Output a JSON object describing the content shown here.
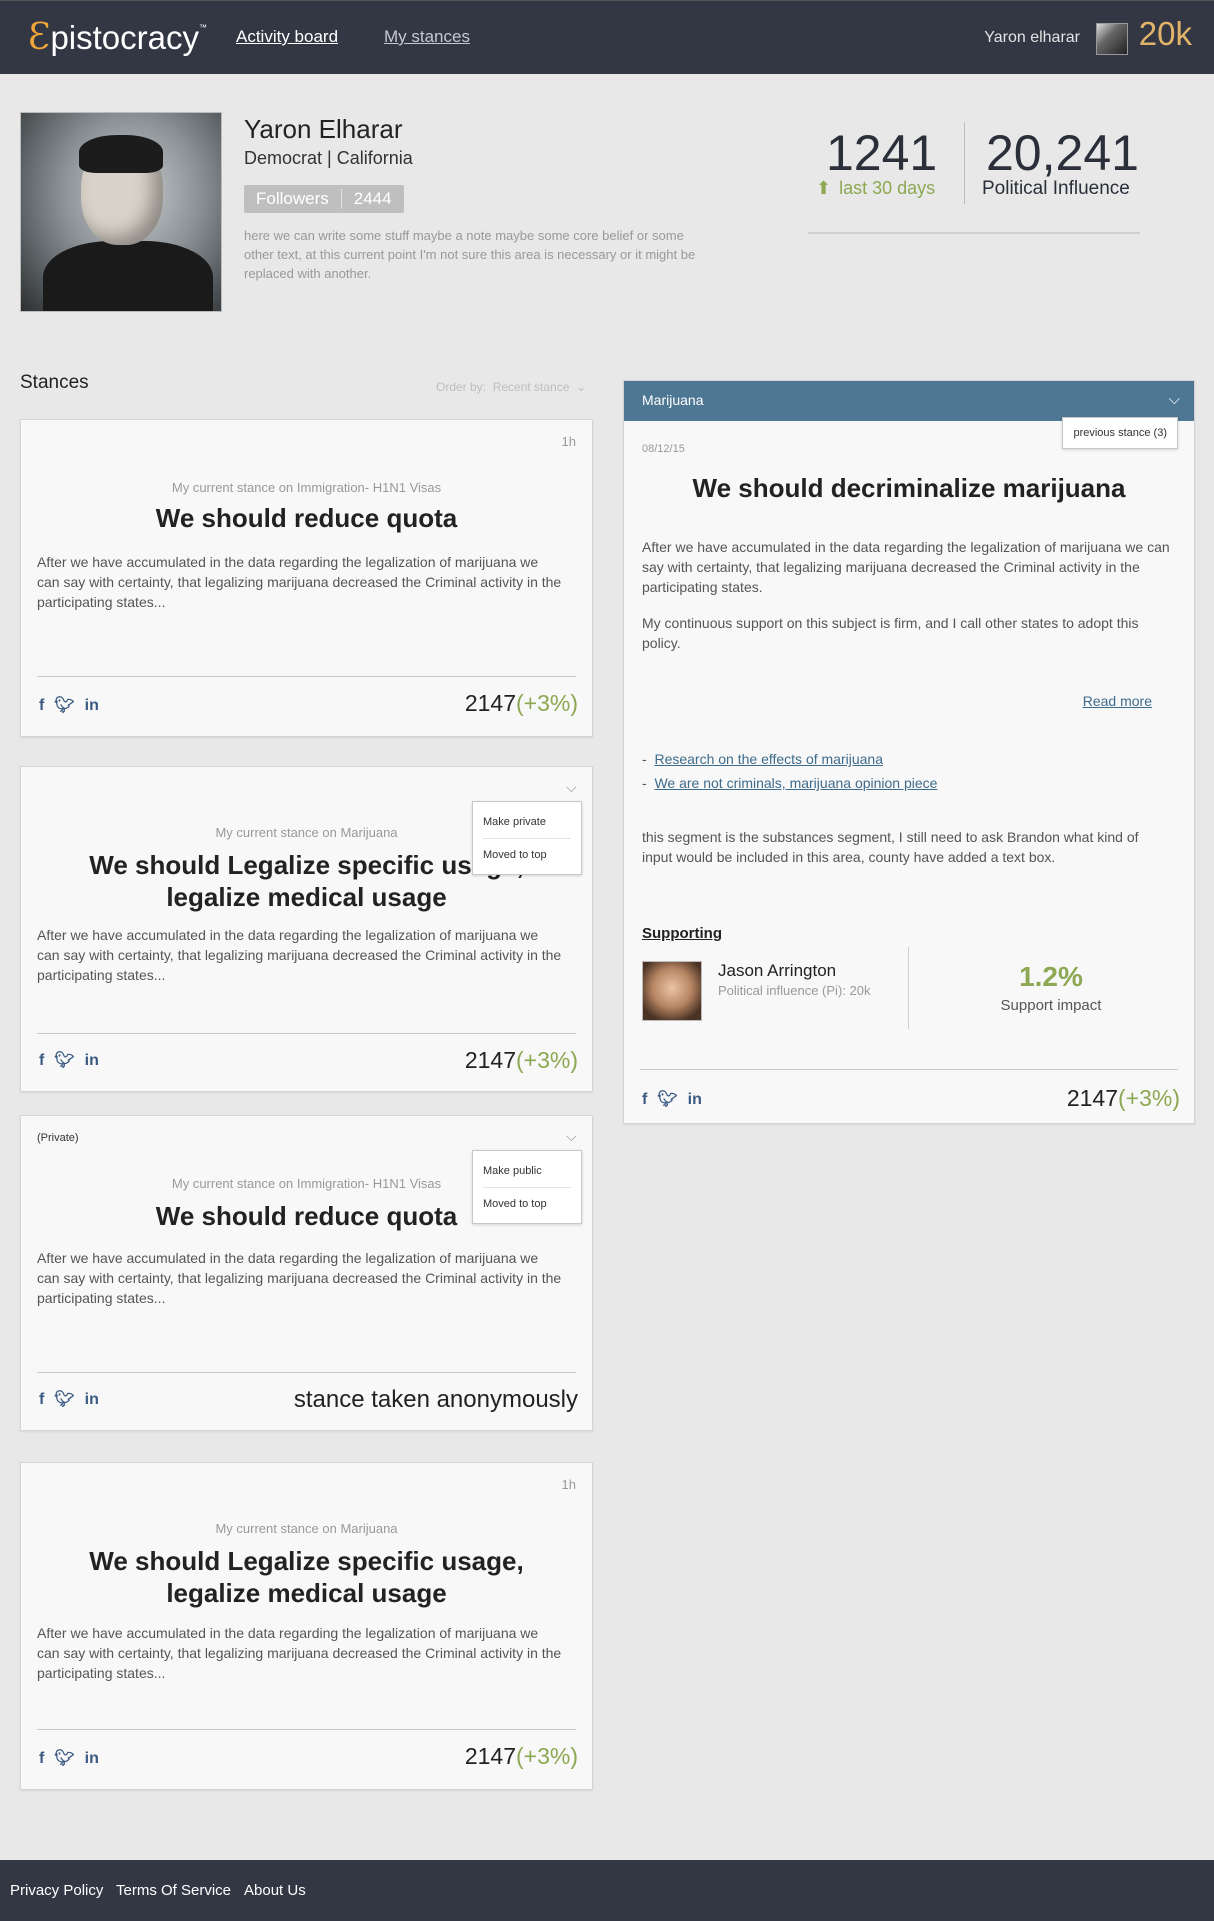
{
  "header": {
    "logo_initial": "Ɛ",
    "logo_rest": "pistocracy",
    "logo_tm": "™",
    "nav": [
      "Activity board",
      "My stances"
    ],
    "user_name": "Yaron elharar",
    "user_score": "20k"
  },
  "profile": {
    "name": "Yaron Elharar",
    "party": "Democrat | California",
    "followers_label": "Followers",
    "followers_count": "2444",
    "bio": "here we can write some stuff maybe a note maybe some core belief  or some other text,  at this current point I'm not sure this area is necessary or it might be replaced with another.",
    "stat1_value": "1241",
    "stat1_label": "last 30 days",
    "stat2_value": "20,241",
    "stat2_label": "Political Influence"
  },
  "stances": {
    "heading": "Stances",
    "order_by_label": "Order by:",
    "order_by_value": "Recent stance",
    "cards": [
      {
        "time": "1h",
        "subtitle": "My current stance on Immigration- H1N1 Visas",
        "title": "We should reduce quota",
        "body": "After we have accumulated in the data regarding the legalization of marijuana we can say with certainty, that legalizing marijuana decreased the Criminal activity in the participating states...",
        "count": "2147",
        "pct": "(+3%)"
      },
      {
        "subtitle": "My current stance on Marijuana",
        "title": "We should Legalize specific usage, legalize medical usage",
        "body": "After we have accumulated in the data regarding the legalization of marijuana we can say with certainty, that legalizing marijuana decreased the Criminal activity in the participating states...",
        "count": "2147",
        "pct": "(+3%)",
        "menu": [
          "Make private",
          "Moved to top"
        ]
      },
      {
        "private_label": "(Private)",
        "subtitle": "My current stance on Immigration- H1N1 Visas",
        "title": "We should reduce quota",
        "body": "After we have accumulated in the data regarding the legalization of marijuana we can say with certainty, that legalizing marijuana decreased the Criminal activity in the participating states...",
        "anon": "stance taken anonymously",
        "menu": [
          "Make public",
          "Moved to top"
        ]
      },
      {
        "time": "1h",
        "subtitle": "My current stance on Marijuana",
        "title": "We should Legalize specific usage, legalize medical usage",
        "body": "After we have accumulated in the data regarding the legalization of marijuana we can say with certainty, that legalizing marijuana decreased the Criminal activity in the participating states...",
        "count": "2147",
        "pct": "(+3%)"
      }
    ]
  },
  "detail": {
    "topic": "Marijuana",
    "previous": "previous stance (3)",
    "date": "08/12/15",
    "title": "We should decriminalize marijuana",
    "para1": "After we have accumulated in the data regarding the legalization of marijuana we can say with certainty, that legalizing marijuana decreased the Criminal activity in the participating states.",
    "para2": "My continuous support on this subject is firm, and I call other states to adopt this policy.",
    "read_more": "Read more",
    "links": [
      "Research on the effects of marijuana",
      "We are not criminals, marijuana opinion piece"
    ],
    "note": "this segment is the substances segment, I still need to ask Brandon what kind of input would be included in this area, county have added a text box.",
    "supporting_label": "Supporting",
    "supporter_name": "Jason Arrington",
    "supporter_pi": "Political influence (Pi): 20k",
    "impact_value": "1.2%",
    "impact_label": "Support impact",
    "count": "2147",
    "pct": "(+3%)"
  },
  "footer": {
    "links": [
      "Privacy Policy",
      "Terms Of Service",
      "About Us"
    ]
  },
  "colors": {
    "nav_bg": "#333744",
    "accent_orange": "#f0a53a",
    "green": "#8ca852",
    "panel_header": "#4e7794",
    "link_blue": "#3e6b8c"
  },
  "icons": [
    "facebook-icon",
    "twitter-icon",
    "linkedin-icon",
    "arrow-up-icon",
    "chevron-down-icon"
  ]
}
